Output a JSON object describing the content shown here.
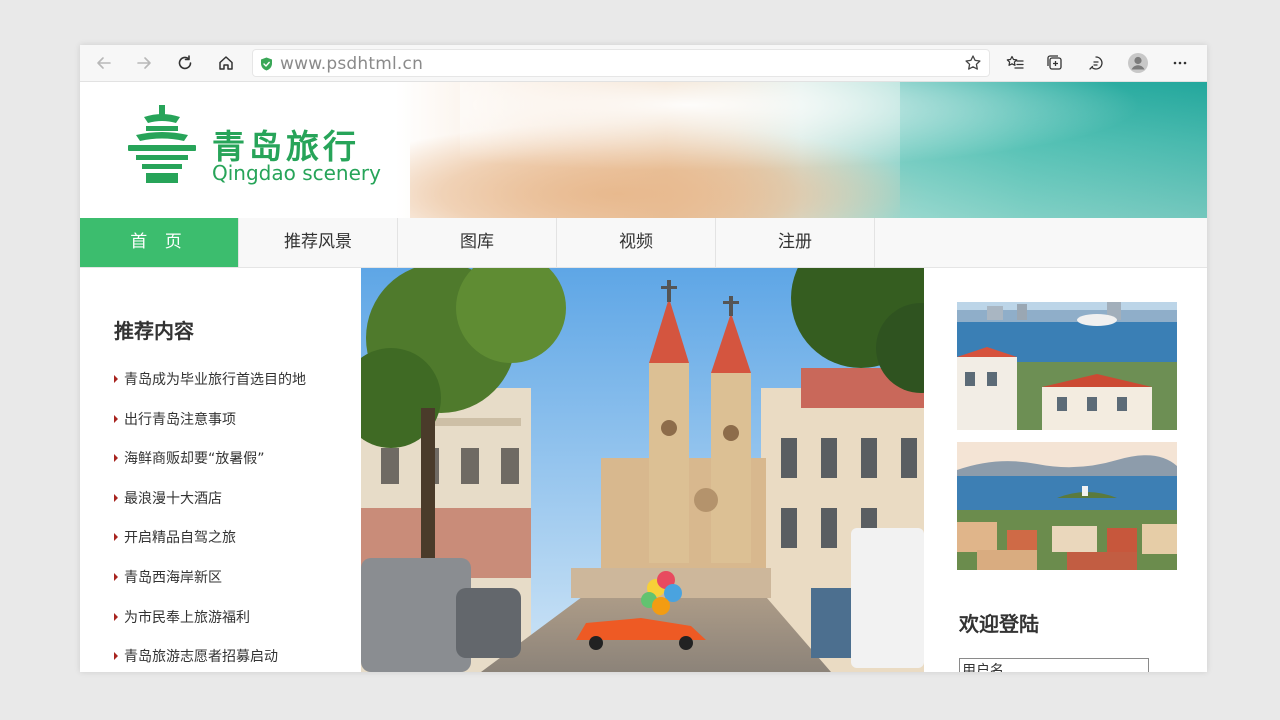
{
  "browser": {
    "url": "www.psdhtml.cn"
  },
  "site": {
    "title_cn": "青岛旅行",
    "title_en": "Qingdao scenery",
    "brand_color": "#27a459"
  },
  "nav": {
    "items": [
      "首 页",
      "推荐风景",
      "图库",
      "视频",
      "注册"
    ],
    "active_index": 0,
    "active_color": "#3cbd6e"
  },
  "sidebar": {
    "heading": "推荐内容",
    "items": [
      "青岛成为毕业旅行首选目的地",
      "出行青岛注意事项",
      "海鲜商贩却要“放暑假”",
      "最浪漫十大酒店",
      "开启精品自驾之旅",
      "青岛西海岸新区",
      "为市民奉上旅游福利",
      "青岛旅游志愿者招募启动"
    ]
  },
  "login": {
    "heading": "欢迎登陆",
    "username_placeholder": "用户名"
  }
}
